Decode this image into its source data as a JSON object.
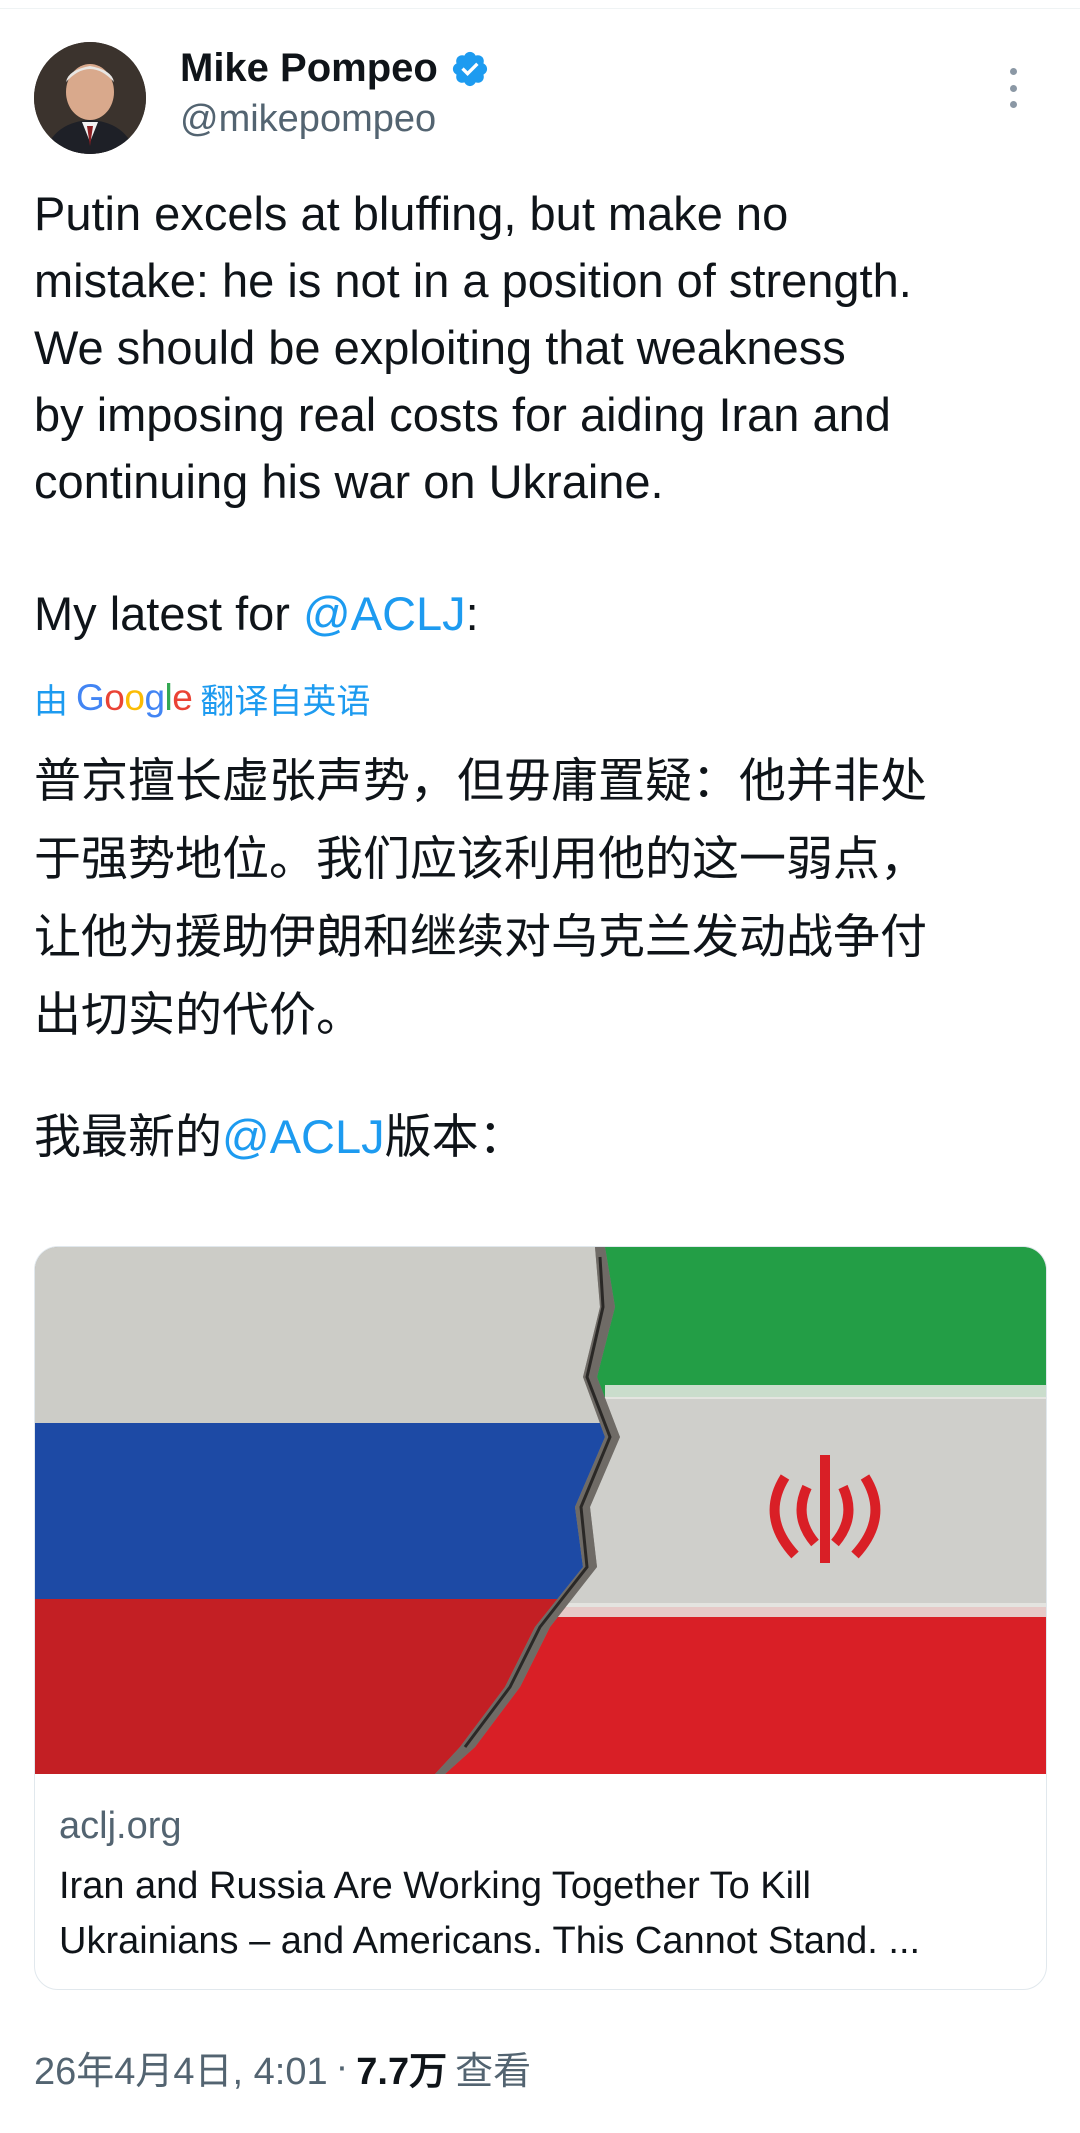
{
  "author": {
    "name": "Mike Pompeo",
    "handle": "@mikepompeo",
    "verified_color": "#1d9bf0"
  },
  "tweet": {
    "lines": [
      "Putin excels at bluffing, but make no",
      "mistake: he is not in a position of strength.",
      "We should be exploiting that weakness",
      "by imposing real costs for aiding Iran and",
      "continuing his war on Ukraine."
    ],
    "latest_prefix": "My latest for ",
    "mention": "@ACLJ",
    "latest_suffix": ":"
  },
  "translation": {
    "by_label": "由",
    "google": "Google",
    "from_label": "翻译自英语",
    "lines": [
      "普京擅长虚张声势，但毋庸置疑：他并非处",
      "于强势地位。我们应该利用他的这一弱点，",
      "让他为援助伊朗和继续对乌克兰发动战争付",
      "出切实的代价。"
    ],
    "latest_prefix": "我最新的",
    "mention": "@ACLJ",
    "latest_suffix": "版本："
  },
  "card": {
    "image_icon": "russia-iran-cracked-flags-image",
    "domain": "aclj.org",
    "title_lines": [
      "Iran and Russia Are Working Together To Kill",
      "Ukrainians – and Americans. This Cannot Stand. ..."
    ]
  },
  "meta": {
    "timestamp": "26年4月4日, 4:01",
    "separator": "·",
    "views": "7.7万",
    "views_label": "查看"
  },
  "colors": {
    "link": "#1d9bf0",
    "secondary_text": "#536471",
    "russia_white": "#d9d9d4",
    "russia_blue": "#1f4fb0",
    "russia_red": "#d02127",
    "iran_green": "#239e46",
    "iran_red": "#d91f26"
  }
}
